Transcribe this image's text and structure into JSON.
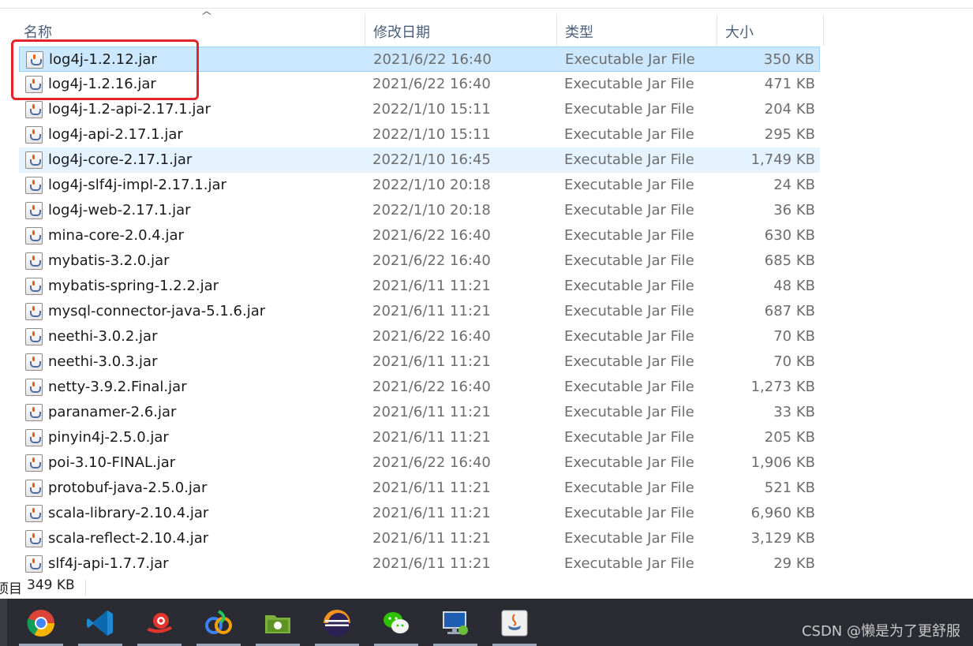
{
  "columns": {
    "name": "名称",
    "date": "修改日期",
    "type": "类型",
    "size": "大小"
  },
  "files": [
    {
      "name": "log4j-1.2.12.jar",
      "date": "2021/6/22 16:40",
      "type": "Executable Jar File",
      "size": "350 KB"
    },
    {
      "name": "log4j-1.2.16.jar",
      "date": "2021/6/22 16:40",
      "type": "Executable Jar File",
      "size": "471 KB"
    },
    {
      "name": "log4j-1.2-api-2.17.1.jar",
      "date": "2022/1/10 15:11",
      "type": "Executable Jar File",
      "size": "204 KB"
    },
    {
      "name": "log4j-api-2.17.1.jar",
      "date": "2022/1/10 15:11",
      "type": "Executable Jar File",
      "size": "295 KB"
    },
    {
      "name": "log4j-core-2.17.1.jar",
      "date": "2022/1/10 16:45",
      "type": "Executable Jar File",
      "size": "1,749 KB"
    },
    {
      "name": "log4j-slf4j-impl-2.17.1.jar",
      "date": "2022/1/10 20:18",
      "type": "Executable Jar File",
      "size": "24 KB"
    },
    {
      "name": "log4j-web-2.17.1.jar",
      "date": "2022/1/10 20:18",
      "type": "Executable Jar File",
      "size": "36 KB"
    },
    {
      "name": "mina-core-2.0.4.jar",
      "date": "2021/6/22 16:40",
      "type": "Executable Jar File",
      "size": "630 KB"
    },
    {
      "name": "mybatis-3.2.0.jar",
      "date": "2021/6/22 16:40",
      "type": "Executable Jar File",
      "size": "685 KB"
    },
    {
      "name": "mybatis-spring-1.2.2.jar",
      "date": "2021/6/11 11:21",
      "type": "Executable Jar File",
      "size": "48 KB"
    },
    {
      "name": "mysql-connector-java-5.1.6.jar",
      "date": "2021/6/11 11:21",
      "type": "Executable Jar File",
      "size": "687 KB"
    },
    {
      "name": "neethi-3.0.2.jar",
      "date": "2021/6/22 16:40",
      "type": "Executable Jar File",
      "size": "70 KB"
    },
    {
      "name": "neethi-3.0.3.jar",
      "date": "2021/6/11 11:21",
      "type": "Executable Jar File",
      "size": "70 KB"
    },
    {
      "name": "netty-3.9.2.Final.jar",
      "date": "2021/6/22 16:40",
      "type": "Executable Jar File",
      "size": "1,273 KB"
    },
    {
      "name": "paranamer-2.6.jar",
      "date": "2021/6/11 11:21",
      "type": "Executable Jar File",
      "size": "33 KB"
    },
    {
      "name": "pinyin4j-2.5.0.jar",
      "date": "2021/6/11 11:21",
      "type": "Executable Jar File",
      "size": "205 KB"
    },
    {
      "name": "poi-3.10-FINAL.jar",
      "date": "2021/6/22 16:40",
      "type": "Executable Jar File",
      "size": "1,906 KB"
    },
    {
      "name": "protobuf-java-2.5.0.jar",
      "date": "2021/6/11 11:21",
      "type": "Executable Jar File",
      "size": "521 KB"
    },
    {
      "name": "scala-library-2.10.4.jar",
      "date": "2021/6/11 11:21",
      "type": "Executable Jar File",
      "size": "6,960 KB"
    },
    {
      "name": "scala-reflect-2.10.4.jar",
      "date": "2021/6/11 11:21",
      "type": "Executable Jar File",
      "size": "3,129 KB"
    },
    {
      "name": "slf4j-api-1.7.7.jar",
      "date": "2021/6/11 11:21",
      "type": "Executable Jar File",
      "size": "29 KB"
    }
  ],
  "selected_index": 0,
  "hover_index": 4,
  "highlight_rows": [
    0,
    1
  ],
  "status": {
    "items_text": "项目",
    "size_text": "349 KB"
  },
  "taskbar": {
    "apps": [
      {
        "icon": "chrome-icon"
      },
      {
        "icon": "vscode-icon"
      },
      {
        "icon": "snail-icon"
      },
      {
        "icon": "colorful-app-icon"
      },
      {
        "icon": "folder-app-icon"
      },
      {
        "icon": "eclipse-icon"
      },
      {
        "icon": "wechat-icon"
      },
      {
        "icon": "remote-desktop-icon"
      },
      {
        "icon": "java-icon"
      }
    ]
  },
  "watermark": "CSDN @懒是为了更舒服",
  "colors": {
    "selection": "#cce8ff",
    "hover": "#e5f3ff",
    "annotation_box": "#e4232a",
    "taskbar": "#2b2c33"
  }
}
